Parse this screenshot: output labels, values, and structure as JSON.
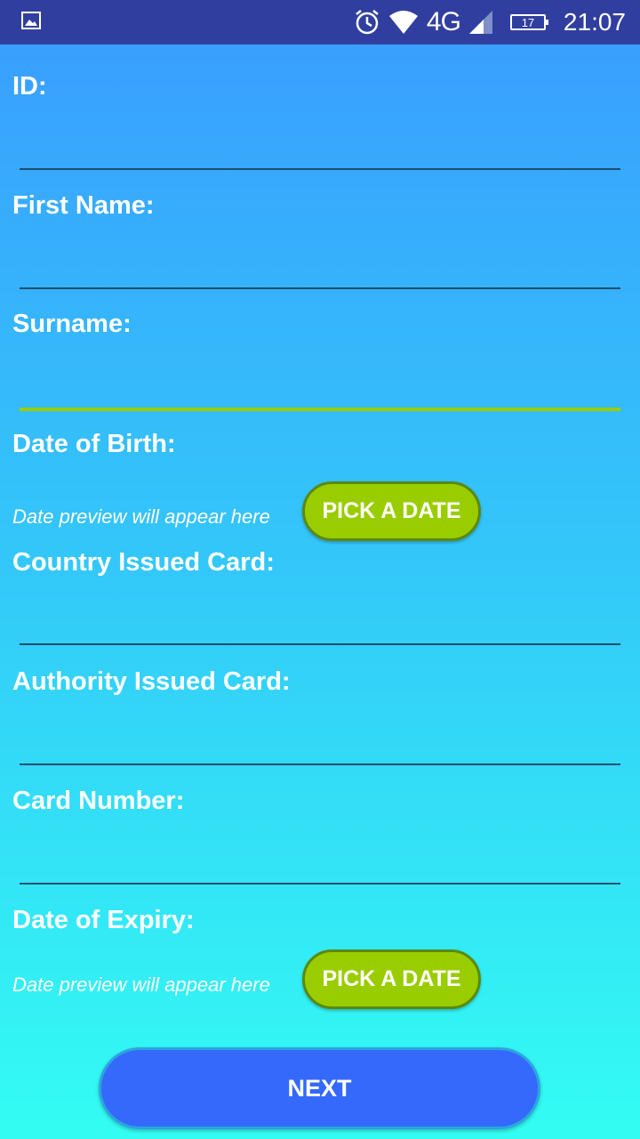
{
  "status_bar": {
    "network": "4G",
    "battery": "17",
    "time": "21:07"
  },
  "form": {
    "id_label": "ID:",
    "id_value": "",
    "first_name_label": "First Name:",
    "first_name_value": "",
    "surname_label": "Surname:",
    "surname_value": "",
    "dob_label": "Date of Birth:",
    "dob_preview": "Date preview will appear here",
    "dob_button": "PICK A DATE",
    "country_label": "Country Issued Card:",
    "country_value": "",
    "authority_label": "Authority Issued Card:",
    "authority_value": "",
    "card_number_label": "Card Number:",
    "card_number_value": "",
    "expiry_label": "Date of Expiry:",
    "expiry_preview": "Date preview will appear here",
    "expiry_button": "PICK A DATE",
    "next_button": "NEXT"
  },
  "colors": {
    "status_bar": "#303f9f",
    "accent_green": "#9acd00",
    "next_button": "#3469fb",
    "gradient_top": "#3a9cff",
    "gradient_bottom": "#33fdf3"
  },
  "icons": {
    "gallery": "gallery-icon",
    "alarm": "alarm-clock-icon",
    "wifi": "wifi-icon",
    "signal": "cell-signal-icon",
    "battery": "battery-icon"
  }
}
